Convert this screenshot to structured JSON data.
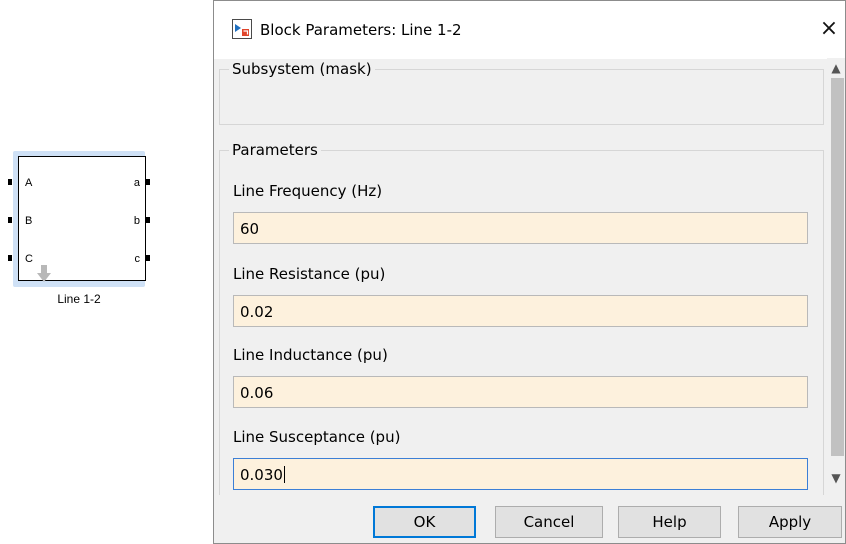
{
  "canvas": {
    "block": {
      "name": "Line 1-2",
      "ports_left": [
        "A",
        "B",
        "C"
      ],
      "ports_right": [
        "a",
        "b",
        "c"
      ]
    }
  },
  "dialog": {
    "title": "Block Parameters: Line 1-2",
    "close_label": "×",
    "subsystem_legend": "Subsystem (mask)",
    "parameters_legend": "Parameters",
    "fields": [
      {
        "label": "Line Frequency (Hz)",
        "value": "60"
      },
      {
        "label": "Line Resistance (pu)",
        "value": "0.02"
      },
      {
        "label": "Line Inductance (pu)",
        "value": "0.06"
      },
      {
        "label": "Line Susceptance (pu)",
        "value": "0.030"
      }
    ],
    "buttons": {
      "ok": "OK",
      "cancel": "Cancel",
      "help": "Help",
      "apply": "Apply"
    }
  },
  "colors": {
    "input_bg": "#fdf1dd",
    "focus_border": "#3c7fd6",
    "default_button_border": "#0078d7",
    "block_highlight": "#cfe1f6"
  },
  "icons": {
    "scroll_up": "▲",
    "scroll_down": "▼"
  }
}
